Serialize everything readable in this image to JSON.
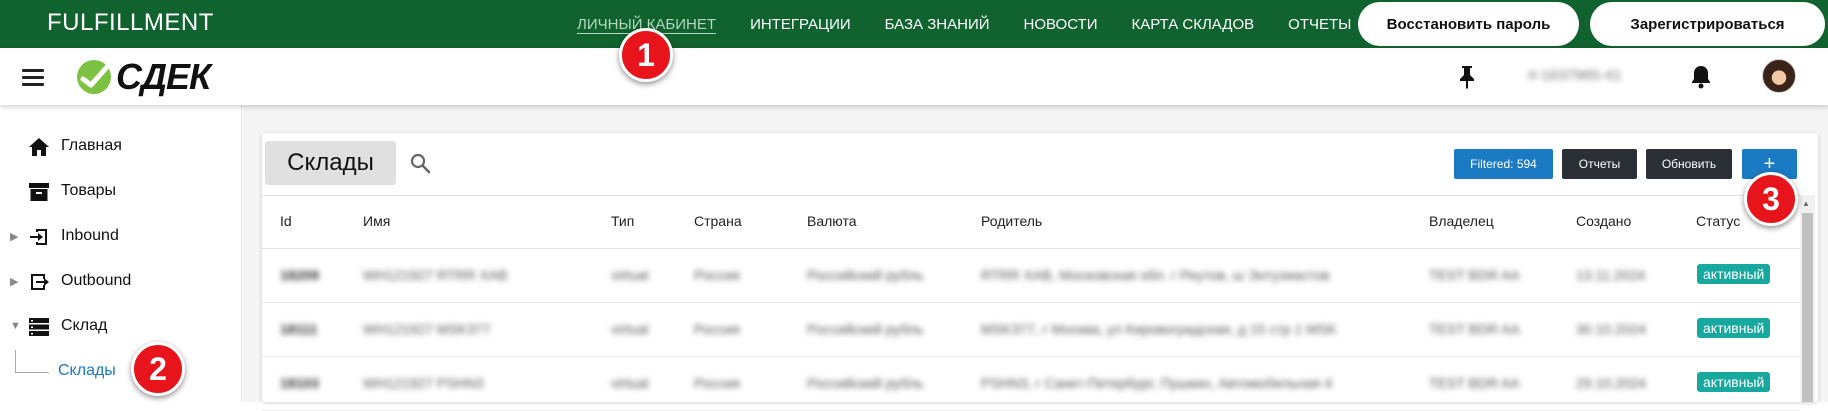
{
  "topbar": {
    "brand": "FULFILLMENT",
    "nav": [
      "ЛИЧНЫЙ КАБИНЕТ",
      "ИНТЕГРАЦИИ",
      "БАЗА ЗНАНИЙ",
      "НОВОСТИ",
      "КАРТА СКЛАДОВ",
      "ОТЧЕТЫ"
    ],
    "restore_label": "Восстановить пароль",
    "register_label": "Зарегистрироваться"
  },
  "header": {
    "logo_text": "СДЕК",
    "account": "#-1637965-41",
    "icons": [
      "menu-icon",
      "pin-icon",
      "bell-icon",
      "avatar"
    ]
  },
  "sidebar": {
    "items": [
      {
        "label": "Главная",
        "icon": "home-icon"
      },
      {
        "label": "Товары",
        "icon": "archive-icon"
      },
      {
        "label": "Inbound",
        "icon": "inbound-icon"
      },
      {
        "label": "Outbound",
        "icon": "outbound-icon"
      },
      {
        "label": "Склад",
        "icon": "warehouse-icon"
      }
    ],
    "sub_item": "Склады"
  },
  "toolbar": {
    "title": "Склады",
    "filtered": "Filtered: 594",
    "reports": "Отчеты",
    "refresh": "Обновить",
    "add": "+"
  },
  "table": {
    "columns": [
      "Id",
      "Имя",
      "Тип",
      "Страна",
      "Валюта",
      "Родитель",
      "Владелец",
      "Создано",
      "Статус"
    ],
    "rows": [
      [
        "18209",
        "WH121927 RTRR XAB",
        "virtual",
        "Россия",
        "Российский рубль",
        "RTRR XAB, Московская обл. г Реутов, ш Энтузиастов",
        "TEST BDR AA",
        "13.11.2024",
        "активный"
      ],
      [
        "18111",
        "WH121927 MSK377",
        "virtual",
        "Россия",
        "Российский рубль",
        "MSK377, г Москва, ул Кировоградская, д 15 стр 1 MSK",
        "TEST BDR AA",
        "30.10.2024",
        "активный"
      ],
      [
        "18103",
        "WH121927 PSHN3",
        "virtual",
        "Россия",
        "Российский рубль",
        "PSHN3, г Санкт-Петербург, Пушкин, Автомобильная 4",
        "TEST BDR AA",
        "29.10.2024",
        "активный"
      ]
    ]
  },
  "markers": [
    "1",
    "2",
    "3"
  ],
  "colors": {
    "topbar": "#10622e",
    "primary": "#1a7ac4",
    "dark_button": "#2b2f36",
    "status": "#17a8a0",
    "marker": "#e8141b"
  }
}
